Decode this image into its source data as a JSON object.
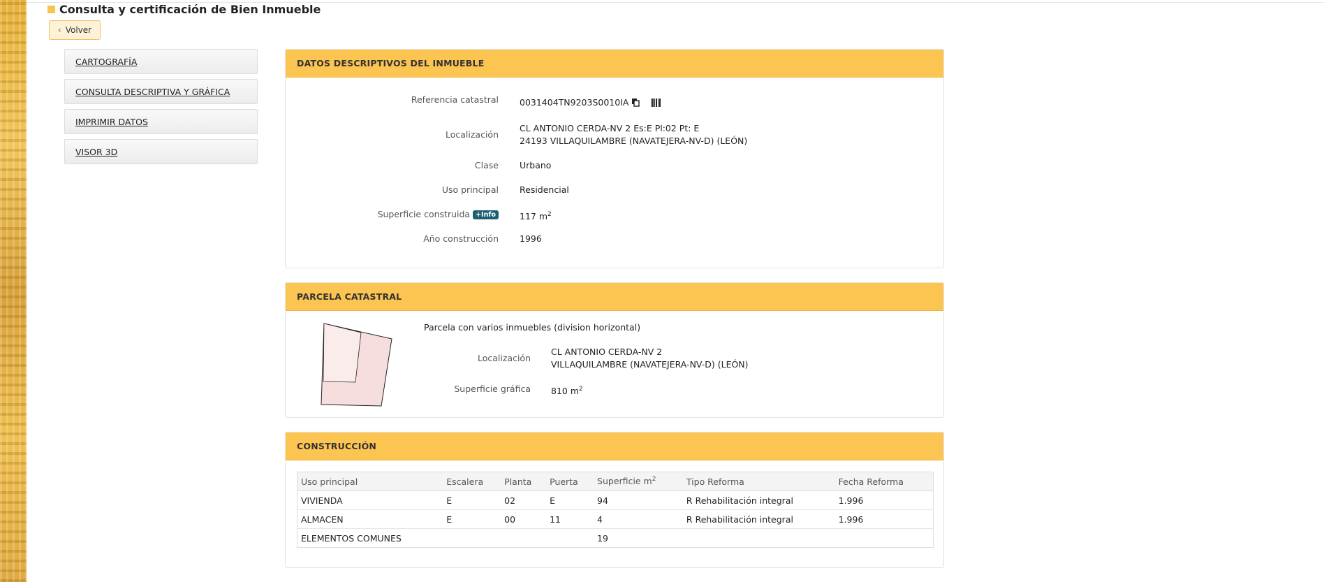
{
  "page": {
    "title": "Consulta y certificación de Bien Inmueble",
    "back_label": "Volver"
  },
  "side_menu": {
    "items": [
      {
        "label": "CARTOGRAFÍA"
      },
      {
        "label": "CONSULTA DESCRIPTIVA Y GRÁFICA"
      },
      {
        "label": "IMPRIMIR DATOS"
      },
      {
        "label": "VISOR 3D"
      }
    ]
  },
  "descriptivos": {
    "header": "DATOS DESCRIPTIVOS DEL INMUEBLE",
    "ref_label": "Referencia catastral",
    "ref_value": "0031404TN9203S0010IA",
    "loc_label": "Localización",
    "loc_line1": "CL ANTONIO CERDA-NV 2 Es:E Pl:02 Pt: E",
    "loc_line2": "24193 VILLAQUILAMBRE (NAVATEJERA-NV-D) (LEÓN)",
    "clase_label": "Clase",
    "clase_value": "Urbano",
    "uso_label": "Uso principal",
    "uso_value": "Residencial",
    "sup_label": "Superficie construida",
    "info_badge": "+Info",
    "sup_value": "117 m",
    "sup_exp": "2",
    "anio_label": "Año construcción",
    "anio_value": "1996"
  },
  "parcela": {
    "header": "PARCELA CATASTRAL",
    "desc": "Parcela con varios inmuebles (division horizontal)",
    "loc_label": "Localización",
    "loc_line1": "CL ANTONIO CERDA-NV 2",
    "loc_line2": "VILLAQUILAMBRE (NAVATEJERA-NV-D) (LEÓN)",
    "sup_label": "Superficie gráfica",
    "sup_value": "810 m",
    "sup_exp": "2"
  },
  "construccion": {
    "header": "CONSTRUCCIÓN",
    "columns": [
      "Uso principal",
      "Escalera",
      "Planta",
      "Puerta",
      "Superficie m",
      "Tipo Reforma",
      "Fecha Reforma"
    ],
    "sup_col_exp": "2",
    "rows": [
      [
        "VIVIENDA",
        "E",
        "02",
        "E",
        "94",
        "R Rehabilitación integral",
        "1.996"
      ],
      [
        "ALMACEN",
        "E",
        "00",
        "11",
        "4",
        "R Rehabilitación integral",
        "1.996"
      ],
      [
        "ELEMENTOS COMUNES",
        "",
        "",
        "",
        "19",
        "",
        ""
      ]
    ]
  },
  "colors": {
    "accent": "#fcc450",
    "badge": "#1f5f74",
    "parcel_fill": "#f7dede"
  }
}
